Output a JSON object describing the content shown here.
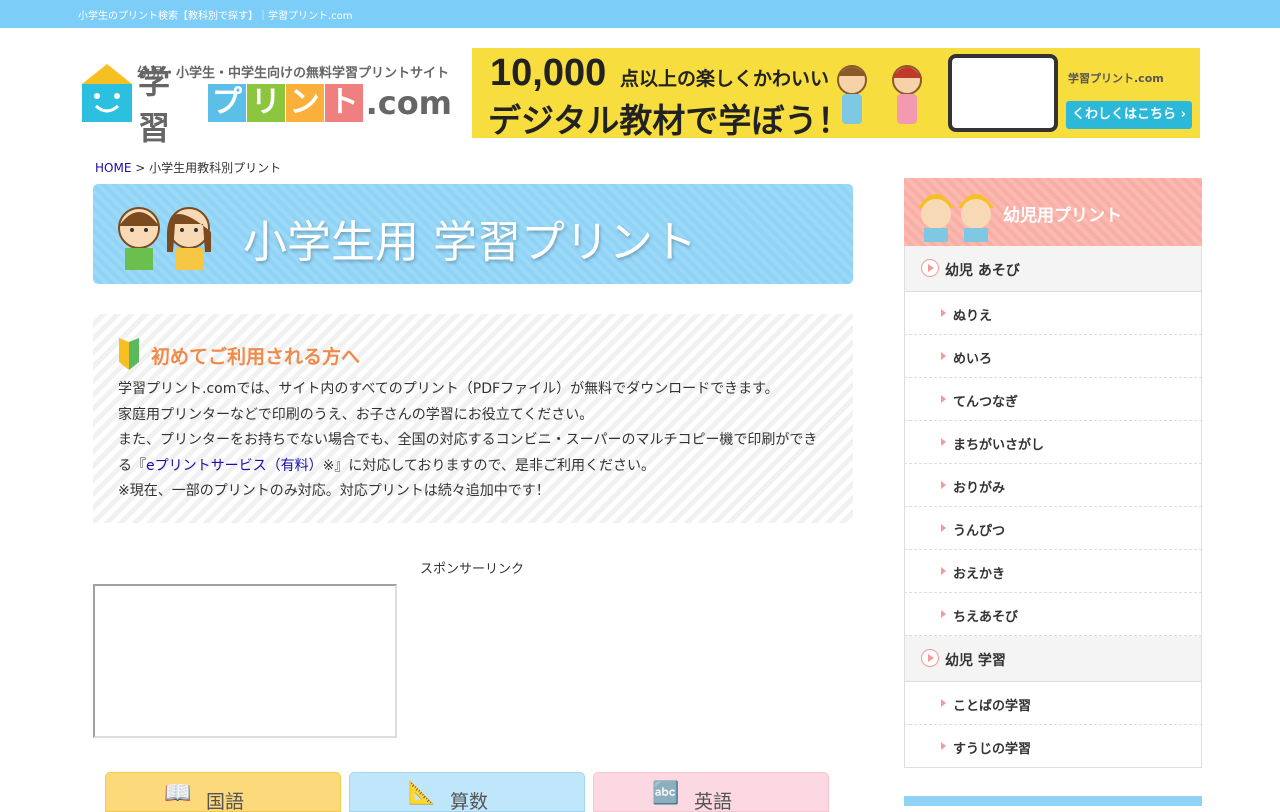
{
  "topbar": {
    "text": "小学生のプリント検索【教科別で探す】｜学習プリント.com"
  },
  "logo": {
    "tagline": "幼児・小学生・中学生向けの無料学習プリントサイト",
    "main_text": "学習",
    "tiles": [
      "プ",
      "リ",
      "ン",
      "ト"
    ],
    "tile_colors": [
      "#5bbfe8",
      "#8cc63f",
      "#fbb03b",
      "#f08080"
    ],
    "suffix": ".com"
  },
  "banner": {
    "count": "10,000",
    "line1": "点以上の楽しくかわいい",
    "line2": "デジタル教材で学ぼう！",
    "mini_logo": "学習プリント.com",
    "button": "くわしくはこちら ›"
  },
  "breadcrumb": {
    "home": "HOME",
    "separator": " > ",
    "current": "小学生用教科別プリント"
  },
  "page_header": {
    "title": "小学生用 学習プリント"
  },
  "intro": {
    "title": "初めてご利用される方へ",
    "line1": "学習プリント.comでは、サイト内のすべてのプリント（PDFファイル）が無料でダウンロードできます。",
    "line2": "家庭用プリンターなどで印刷のうえ、お子さんの学習にお役立てください。",
    "line3": "また、プリンターをお持ちでない場合でも、全国の対応するコンビニ・スーパーのマルチコピー機で印刷ができ",
    "line4_pre": "る『",
    "line4_link": "eプリントサービス（有料）",
    "line4_post": "※』に対応しておりますので、是非ご利用ください。",
    "line5": "※現在、一部のプリントのみ対応。対応プリントは続々追加中です！"
  },
  "sponsor": {
    "label": "スポンサーリンク"
  },
  "subjects": [
    {
      "label": "国語",
      "icon": "📖"
    },
    {
      "label": "算数",
      "icon": "📐"
    },
    {
      "label": "英語",
      "icon": "🔤"
    }
  ],
  "sidebar": {
    "header": "幼児用プリント",
    "sections": [
      {
        "title": "幼児 あそび",
        "items": [
          "ぬりえ",
          "めいろ",
          "てんつなぎ",
          "まちがいさがし",
          "おりがみ",
          "うんぴつ",
          "おえかき",
          "ちえあそび"
        ]
      },
      {
        "title": "幼児 学習",
        "items": [
          "ことばの学習",
          "すうじの学習"
        ]
      }
    ]
  },
  "colors": {
    "topbar": "#7ccdf7",
    "header_blue": "#8fd3f6",
    "sidebar_pink": "#f9aea5",
    "intro_title": "#f08a4b",
    "link": "#1a0dab"
  }
}
